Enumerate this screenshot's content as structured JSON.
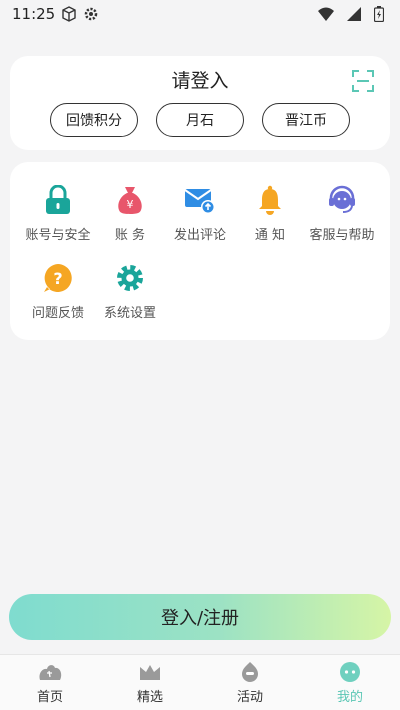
{
  "status_bar": {
    "time": "11:25"
  },
  "login_card": {
    "title": "请登入",
    "pills": [
      "回馈积分",
      "月石",
      "晋江币"
    ]
  },
  "menu": {
    "items": [
      {
        "label": "账号与安全",
        "icon": "lock-icon",
        "color": "#1aa59a"
      },
      {
        "label": "账 务",
        "icon": "money-bag-icon",
        "color": "#e8566b"
      },
      {
        "label": "发出评论",
        "icon": "mail-upload-icon",
        "color": "#2f8de4"
      },
      {
        "label": "通 知",
        "icon": "bell-icon",
        "color": "#f5a623"
      },
      {
        "label": "客服与帮助",
        "icon": "headset-icon",
        "color": "#6a6fd6"
      },
      {
        "label": "问题反馈",
        "icon": "question-icon",
        "color": "#f5a623"
      },
      {
        "label": "系统设置",
        "icon": "gear-icon",
        "color": "#1aa59a"
      }
    ]
  },
  "login_button": {
    "label": "登入/注册"
  },
  "bottom_nav": {
    "items": [
      {
        "label": "首页",
        "icon": "home-icon"
      },
      {
        "label": "精选",
        "icon": "crown-icon"
      },
      {
        "label": "活动",
        "icon": "activity-icon"
      },
      {
        "label": "我的",
        "icon": "profile-icon",
        "active": true
      }
    ],
    "accent": "#5bc7b5"
  }
}
